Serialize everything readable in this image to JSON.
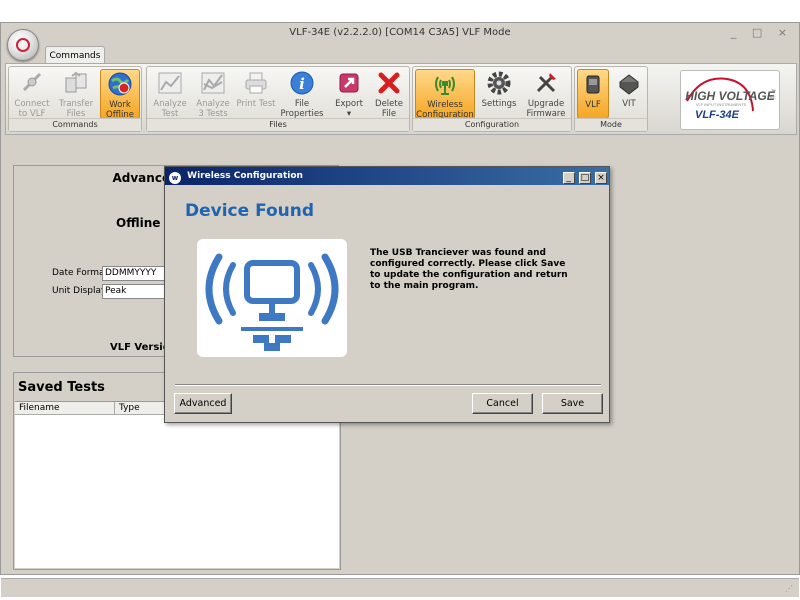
{
  "window": {
    "title": "VLF-34E (v2.2.2.0) [COM14 C3A5]  VLF Mode",
    "controls": "_ □ ×"
  },
  "tabs": [
    {
      "label": "Commands"
    }
  ],
  "ribbon": {
    "groups": [
      {
        "label": "Commands",
        "buttons": [
          {
            "label": "Connect to VLF",
            "icon": "connect-icon",
            "state": "disabled"
          },
          {
            "label": "Transfer Files",
            "icon": "transfer-icon",
            "state": "disabled"
          },
          {
            "label": "Work Offline",
            "icon": "globe-icon",
            "state": "active"
          }
        ]
      },
      {
        "label": "Files",
        "buttons": [
          {
            "label": "Analyze Test",
            "icon": "chart-icon",
            "state": "disabled"
          },
          {
            "label": "Analyze 3 Tests",
            "icon": "chart-multi-icon",
            "state": "disabled"
          },
          {
            "label": "Print Test",
            "icon": "printer-icon",
            "state": "disabled"
          },
          {
            "label": "File Properties",
            "icon": "info-icon",
            "state": "enabled"
          },
          {
            "label": "Export",
            "icon": "export-icon",
            "state": "enabled"
          },
          {
            "label": "Delete File",
            "icon": "delete-icon",
            "state": "enabled"
          }
        ]
      },
      {
        "label": "Configuration",
        "buttons": [
          {
            "label": "Wireless Configuration",
            "icon": "wireless-icon",
            "state": "active"
          },
          {
            "label": "Settings",
            "icon": "gear-icon",
            "state": "enabled"
          },
          {
            "label": "Upgrade Firmware",
            "icon": "tools-icon",
            "state": "enabled"
          }
        ]
      },
      {
        "label": "Mode",
        "buttons": [
          {
            "label": "VLF",
            "icon": "vlf-device-icon",
            "state": "active"
          },
          {
            "label": "VIT",
            "icon": "vit-device-icon",
            "state": "enabled"
          }
        ]
      }
    ],
    "export_arrow": "▾"
  },
  "logo": {
    "brand": "HIGH VOLTAGE",
    "tagline": "VLF INPUT INSTRUMENTS",
    "tm": "™",
    "inc": "INC",
    "model": "VLF-34E"
  },
  "advanced_settings": {
    "title": "Advanced Settings",
    "mode_partial": "Offline M",
    "date_format_label": "Date Format",
    "date_format_value": "DDMMYYYY",
    "unit_display_label": "Unit Display",
    "unit_display_value": "Peak",
    "version_partial": "VLF Version"
  },
  "saved_tests": {
    "title": "Saved Tests",
    "columns": [
      {
        "label": "Filename"
      },
      {
        "label": "Type"
      }
    ]
  },
  "dialog": {
    "title": "Wireless Configuration",
    "title_icon": "w",
    "title_buttons": [
      "_",
      "□",
      "×"
    ],
    "heading": "Device Found",
    "message": "The USB Tranciever was found and configured correctly.  Please click Save to update the configuration and return to the main program.",
    "buttons": {
      "advanced": "Advanced",
      "cancel": "Cancel",
      "save": "Save"
    }
  },
  "statusbar": {
    "grip": "⋰"
  },
  "colors": {
    "accent_blue": "#1f64b0",
    "active_orange": "#f5a623",
    "logo_red": "#c8102e"
  }
}
